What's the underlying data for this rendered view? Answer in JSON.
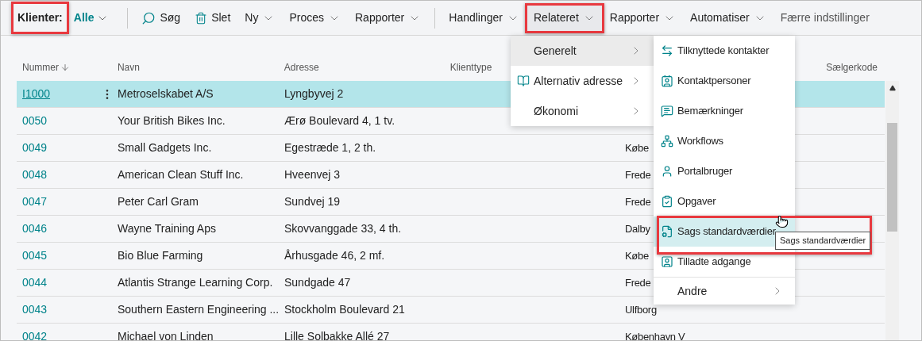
{
  "toolbar": {
    "filter": {
      "label": "Klienter:",
      "value": "Alle",
      "highlighted": true
    },
    "actions": [
      {
        "kind": "separator"
      },
      {
        "kind": "search",
        "label": "Søg",
        "selected": false,
        "highlighted": false
      },
      {
        "kind": "delete",
        "label": "Slet",
        "selected": false,
        "highlighted": false
      },
      {
        "kind": "dropdown",
        "label": "Ny",
        "selected": false,
        "highlighted": false
      },
      {
        "kind": "dropdown",
        "label": "Proces",
        "selected": false,
        "highlighted": false
      },
      {
        "kind": "dropdown",
        "label": "Rapporter",
        "selected": false,
        "highlighted": false
      },
      {
        "kind": "separator"
      },
      {
        "kind": "dropdown",
        "label": "Handlinger",
        "selected": false,
        "highlighted": false
      },
      {
        "kind": "dropdown",
        "label": "Relateret",
        "selected": true,
        "highlighted": true
      },
      {
        "kind": "dropdown",
        "label": "Rapporter",
        "selected": false,
        "highlighted": false
      },
      {
        "kind": "dropdown",
        "label": "Automatiser",
        "selected": false,
        "highlighted": false
      },
      {
        "kind": "plain",
        "label": "Færre indstillinger",
        "selected": false,
        "highlighted": false
      }
    ]
  },
  "table": {
    "columns": [
      {
        "label": "Nummer",
        "sorted": true
      },
      {
        "label": "Navn",
        "sorted": false
      },
      {
        "label": "Adresse",
        "sorted": false
      },
      {
        "label": "Klienttype",
        "sorted": false
      },
      {
        "label": "Sælgerkode",
        "sorted": false
      }
    ],
    "rows": [
      {
        "number": "I1000",
        "name": "Metroselskabet A/S",
        "address": "Lyngbyvej 2",
        "selected": true
      },
      {
        "number": "0050",
        "name": "Your British Bikes Inc.",
        "address": "Ærø Boulevard 4, 1 tv.",
        "selected": false
      },
      {
        "number": "0049",
        "name": "Small Gadgets Inc.",
        "address": "Egestræde 1, 2 th.",
        "city": "Købe",
        "selected": false
      },
      {
        "number": "0048",
        "name": "American Clean Stuff Inc.",
        "address": "Hveenvej 3",
        "city": "Frede",
        "selected": false
      },
      {
        "number": "0047",
        "name": "Peter Carl Gram",
        "address": "Sundvej 19",
        "city": "Frede",
        "selected": false
      },
      {
        "number": "0046",
        "name": "Wayne Training Aps",
        "address": "Skovvanggade 33, 4 th.",
        "city": "Dalby",
        "selected": false
      },
      {
        "number": "0045",
        "name": "Bio Blue Farming",
        "address": "Århusgade 46, 2 mf.",
        "city": "Købe",
        "selected": false
      },
      {
        "number": "0044",
        "name": "Atlantis Strange Learning Corp.",
        "address": "Sundgade 47",
        "city": "Frede",
        "selected": false
      },
      {
        "number": "0043",
        "name": "Southern Eastern Engineering ...",
        "address": "Stockholm Boulevard 21",
        "city": "Ulfborg",
        "selected": false
      },
      {
        "number": "0042",
        "name": "Michael von Linden",
        "address": "Lille Solbakke Allé 27",
        "city": "København V",
        "selected": false
      }
    ]
  },
  "related_menu": {
    "items": [
      {
        "label": "Generelt",
        "selected": true,
        "submenu": true
      },
      {
        "label": "Alternativ adresse",
        "selected": false,
        "submenu": true
      },
      {
        "label": "Økonomi",
        "selected": false,
        "submenu": true
      }
    ]
  },
  "submenu": {
    "items": [
      {
        "label": "Tilknyttede kontakter",
        "selected": false,
        "highlighted": false
      },
      {
        "label": "Kontaktpersoner",
        "selected": false,
        "highlighted": false
      },
      {
        "label": "Bemærkninger",
        "selected": false,
        "highlighted": false
      },
      {
        "label": "Workflows",
        "selected": false,
        "highlighted": false
      },
      {
        "label": "Portalbruger",
        "selected": false,
        "highlighted": false
      },
      {
        "label": "Opgaver",
        "selected": false,
        "highlighted": false
      },
      {
        "label": "Sags standardværdier",
        "selected": true,
        "highlighted": true
      },
      {
        "label": "Tilladte adgange",
        "selected": false,
        "highlighted": false
      }
    ],
    "more": {
      "label": "Andre"
    }
  },
  "tooltip": {
    "text": "Sags standardværdier"
  }
}
